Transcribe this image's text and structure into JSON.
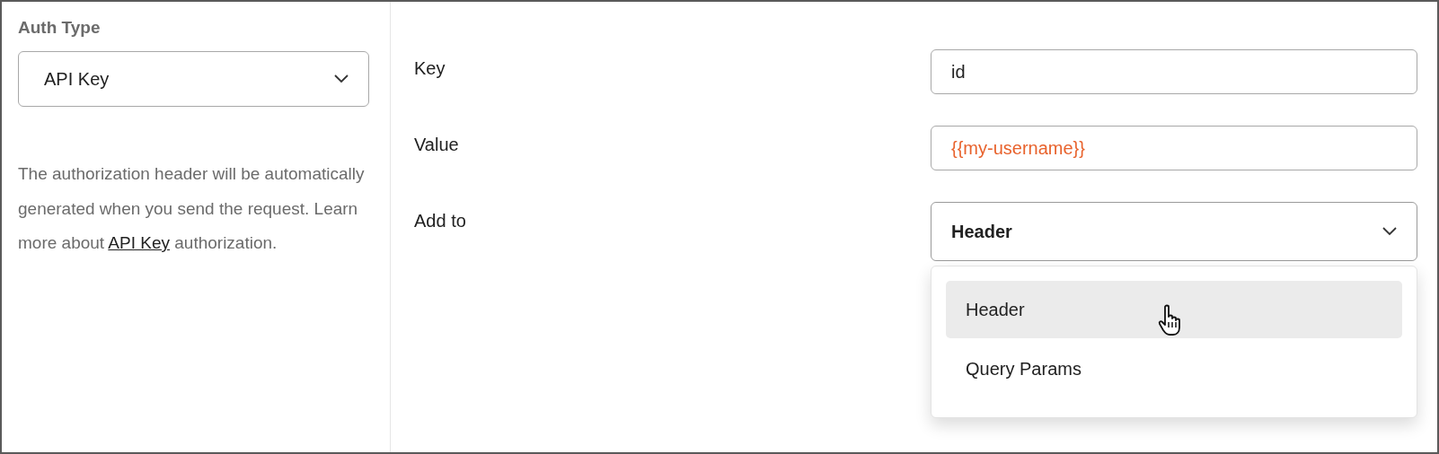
{
  "auth_type": {
    "label": "Auth Type",
    "value": "API Key"
  },
  "description": {
    "text": "The authorization header will be automatically generated when you send the request. Learn more about ",
    "link": "API Key",
    "suffix": " authorization."
  },
  "fields": [
    {
      "kind": "input",
      "label": "Key",
      "value": "id",
      "variable": false
    },
    {
      "kind": "input",
      "label": "Value",
      "value": "{{my-username}}",
      "variable": true
    },
    {
      "kind": "select",
      "label": "Add to",
      "value": "Header",
      "expanded": true
    }
  ],
  "menu": [
    {
      "label": "Header",
      "selected": true
    },
    {
      "label": "Query Params",
      "selected": false
    }
  ]
}
